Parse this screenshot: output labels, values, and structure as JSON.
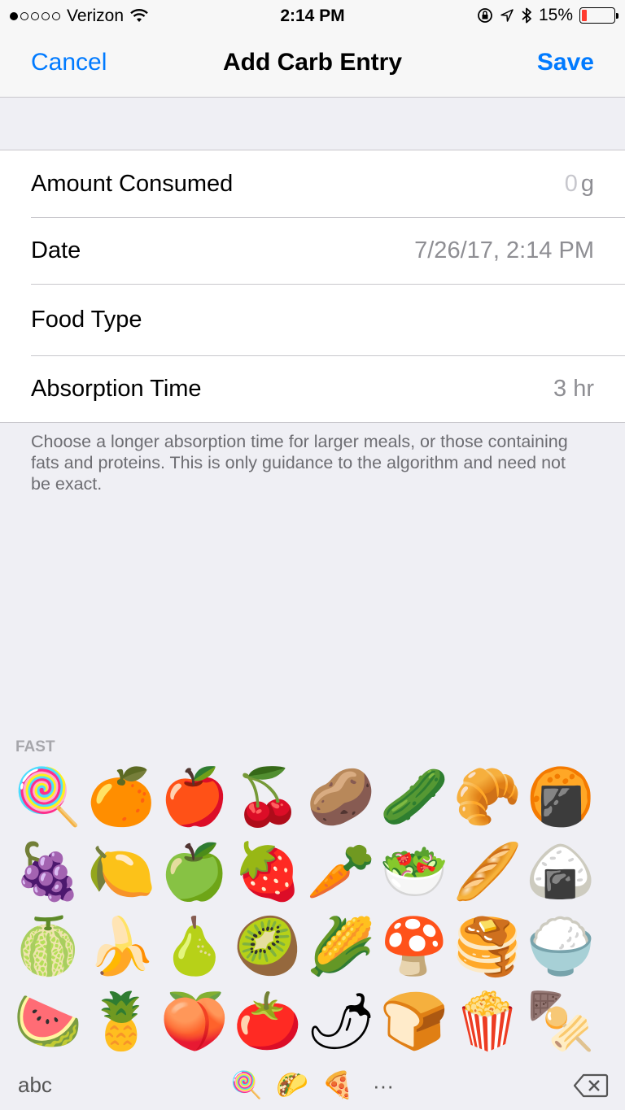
{
  "status_bar": {
    "carrier": "Verizon",
    "time": "2:14 PM",
    "battery_percent": "15%",
    "battery_level": 0.15,
    "signal_bars": 1
  },
  "nav": {
    "cancel": "Cancel",
    "title": "Add Carb Entry",
    "save": "Save"
  },
  "form": {
    "amount_label": "Amount Consumed",
    "amount_placeholder": "0",
    "amount_unit": "g",
    "date_label": "Date",
    "date_value": "7/26/17, 2:14 PM",
    "food_type_label": "Food Type",
    "absorption_label": "Absorption Time",
    "absorption_value": "3 hr",
    "footer": "Choose a longer absorption time for larger meals, or those containing fats and proteins. This is only guidance to the algorithm and need not be exact."
  },
  "keyboard": {
    "section": "FAST",
    "emoji_columns": [
      [
        "🍭",
        "🍇",
        "🍈",
        "🍉"
      ],
      [
        "🍊",
        "🍋",
        "🍌",
        "🍍"
      ],
      [
        "🍎",
        "🍏",
        "🍐",
        "🍑"
      ],
      [
        "🍒",
        "🍓",
        "🥝",
        "🍅"
      ],
      [
        "🥔",
        "🥕",
        "🌽",
        "🌶"
      ],
      [
        "🥒",
        "🥗",
        "🍄",
        "🍞"
      ],
      [
        "🥐",
        "🥖",
        "🥞",
        "🍿"
      ],
      [
        "🍘",
        "🍙",
        "🍚",
        "🍢"
      ]
    ],
    "abc": "abc",
    "categories": [
      "🍭",
      "🌮",
      "🍕"
    ],
    "more": "···"
  },
  "colors": {
    "accent": "#007aff",
    "battery_low": "#ff3b30"
  }
}
